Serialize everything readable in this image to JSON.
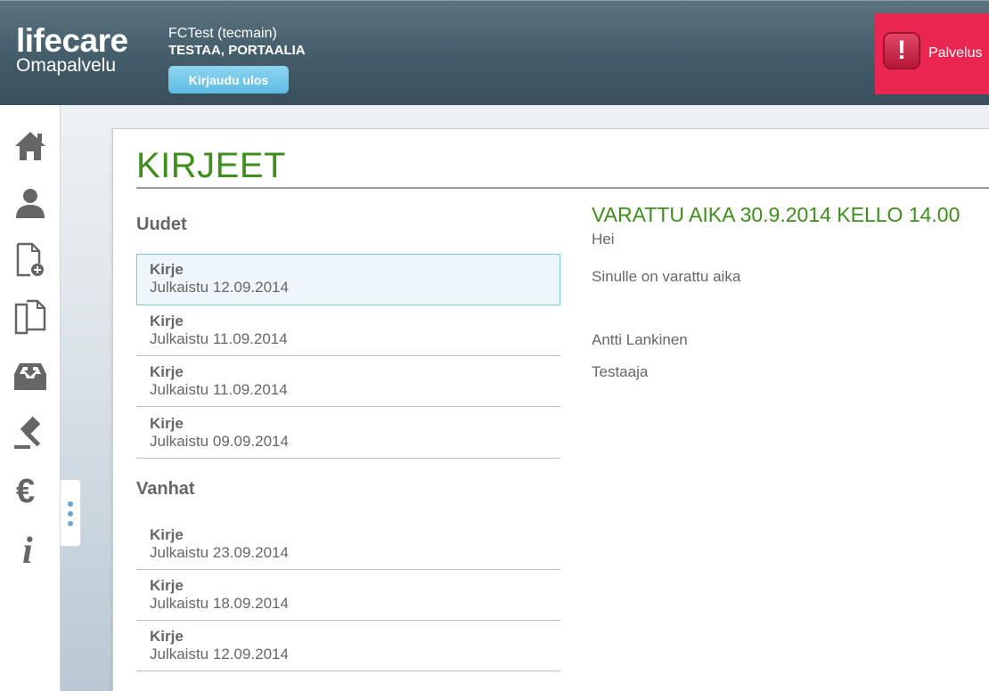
{
  "header": {
    "logo_main": "lifecare",
    "logo_sub": "Omapalvelu",
    "user_name": "FCTest (tecmain)",
    "user_org": "TESTAA, PORTAALIA",
    "logout_label": "Kirjaudu ulos",
    "service_label": "Palvelus",
    "alert_symbol": "!"
  },
  "sidebar": {
    "icons": [
      "home-icon",
      "user-icon",
      "new-document-icon",
      "documents-icon",
      "inbox-icon",
      "gavel-icon",
      "euro-icon",
      "info-icon"
    ]
  },
  "page": {
    "title": "KIRJEET"
  },
  "letters": {
    "new_heading": "Uudet",
    "new_items": [
      {
        "title": "Kirje",
        "date": "Julkaistu 12.09.2014"
      },
      {
        "title": "Kirje",
        "date": "Julkaistu 11.09.2014"
      },
      {
        "title": "Kirje",
        "date": "Julkaistu 11.09.2014"
      },
      {
        "title": "Kirje",
        "date": "Julkaistu 09.09.2014"
      }
    ],
    "old_heading": "Vanhat",
    "old_items": [
      {
        "title": "Kirje",
        "date": "Julkaistu 23.09.2014"
      },
      {
        "title": "Kirje",
        "date": "Julkaistu 18.09.2014"
      },
      {
        "title": "Kirje",
        "date": "Julkaistu 12.09.2014"
      }
    ]
  },
  "message": {
    "subject": "VARATTU AIKA 30.9.2014 KELLO 14.00",
    "greeting": "Hei",
    "body": "Sinulle on varattu aika",
    "sender": "Antti Lankinen",
    "role": "Testaaja"
  },
  "colors": {
    "title_green": "#3e8e1c",
    "header_bg": "#46606d",
    "alert_red": "#e8264f",
    "logout_blue": "#5cbbe3"
  }
}
